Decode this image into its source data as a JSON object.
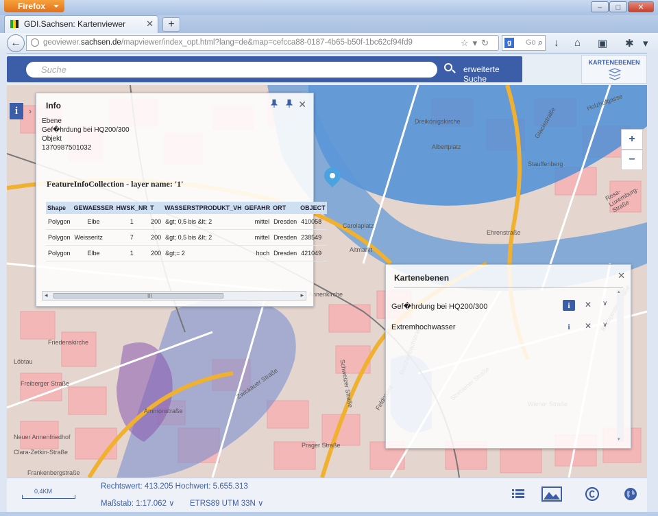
{
  "browser": {
    "app_button": "Firefox",
    "tab_title": "GDI.Sachsen: Kartenviewer",
    "new_tab": "+",
    "url_prefix": "geoviewer.",
    "url_domain": "sachsen.de",
    "url_suffix": "/mapviewer/index_opt.html?lang=de&map=cefcca88-0187-4b65-b50f-1bc62cf94fd9",
    "search_placeholder": "Go"
  },
  "header": {
    "search_placeholder": "Suche",
    "advanced_search": "erweiterte Suche",
    "layers_button": "KARTENEBENEN"
  },
  "info_panel": {
    "title": "Info",
    "lines": [
      "Ebene",
      "Gef�hrdung bei HQ200/300",
      "Objekt",
      "1370987501032"
    ],
    "collection_title": "FeatureInfoCollection - layer name: '1'",
    "columns": [
      "Shape",
      "GEWAESSER",
      "HWSK_NR",
      "T",
      "WASSERSTPRODUKT_VH",
      "GEFAHR",
      "ORT",
      "OBJECT"
    ],
    "rows": [
      [
        "Polygon",
        "Elbe",
        "1",
        "200",
        "&gt; 0,5 bis &lt; 2",
        "mittel",
        "Dresden",
        "410058"
      ],
      [
        "Polygon",
        "Weisseritz",
        "7",
        "200",
        "&gt; 0,5 bis &lt; 2",
        "mittel",
        "Dresden",
        "238549"
      ],
      [
        "Polygon",
        "Elbe",
        "1",
        "200",
        "&gt;= 2",
        "hoch",
        "Dresden",
        "421049"
      ]
    ],
    "scroll_grip": "III"
  },
  "layers_panel": {
    "title": "Kartenebenen",
    "layers": [
      {
        "name": "Gef�hrdung bei HQ200/300",
        "active": true
      },
      {
        "name": "Extremhochwasser",
        "active": false
      }
    ]
  },
  "map": {
    "zoom_in": "+",
    "zoom_out": "−",
    "labels": [
      "Holzhofgasse",
      "Dreikönigskirche",
      "Glacisstraße",
      "Albertplatz",
      "Stauffenberg",
      "Rosa-Luxemburg-Straße",
      "Carolaplatz",
      "Ehrenstraße",
      "Altmarkt",
      "Annenkirche",
      "Friedenskirche",
      "Löbtau",
      "Freiberger Straße",
      "Neuer Annenfriedhof",
      "Clara-Zetkin-Straße",
      "Frankenbergstraße",
      "Schweizer Straße",
      "Reichenbachstraße",
      "Budapester Straße",
      "Zwickauer Straße",
      "Feldgasse",
      "Strehlener Straße",
      "Wiener Straße",
      "Prager Straße",
      "Ammonstraße"
    ]
  },
  "footer": {
    "scale_label": "0,4KM",
    "coords": "Rechtswert: 413.205 Hochwert: 5.655.313",
    "scale": "Maßstab: 1:17.062",
    "crs": "ETRS89 UTM 33N"
  }
}
